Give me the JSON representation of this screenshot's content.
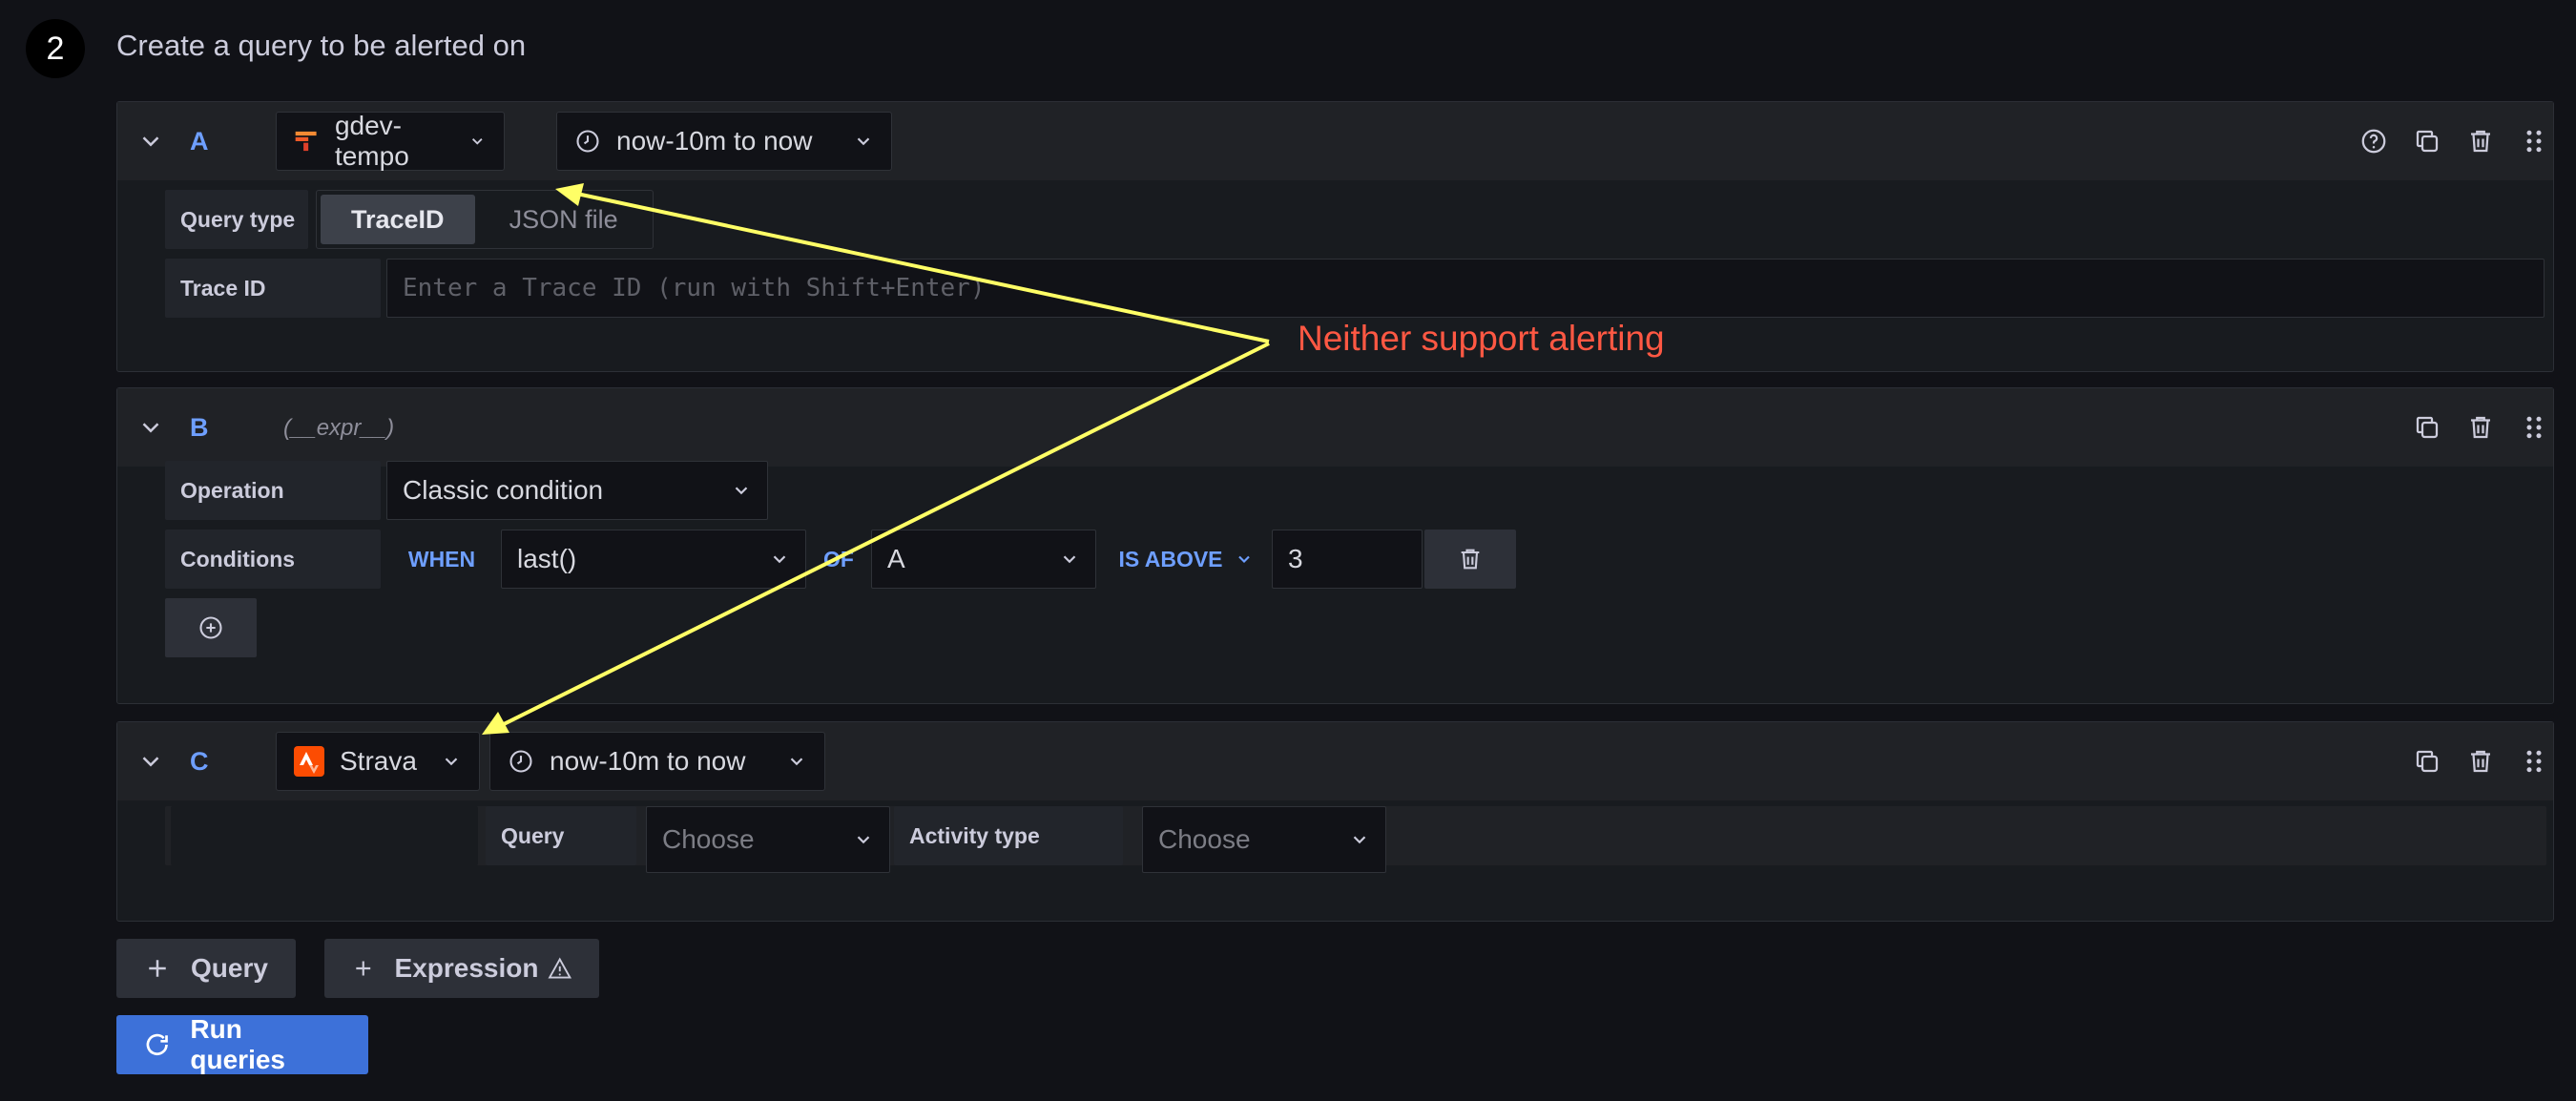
{
  "step": {
    "number": "2",
    "title": "Create a query to be alerted on"
  },
  "queries": {
    "a": {
      "ref_id": "A",
      "datasource": "gdev-tempo",
      "time_range": "now-10m to now",
      "query_type_label": "Query type",
      "query_type_options": [
        "TraceID",
        "JSON file"
      ],
      "trace_id_label": "Trace ID",
      "trace_id_placeholder": "Enter a Trace ID (run with Shift+Enter)"
    },
    "b": {
      "ref_id": "B",
      "hint": "(__expr__)",
      "operation_label": "Operation",
      "operation_value": "Classic condition",
      "conditions_label": "Conditions",
      "when": "WHEN",
      "reducer": "last()",
      "of": "OF",
      "query_ref": "A",
      "evaluator": "IS ABOVE",
      "threshold": "3"
    },
    "c": {
      "ref_id": "C",
      "datasource": "Strava",
      "time_range": "now-10m to now",
      "query_label": "Query",
      "query_placeholder": "Choose",
      "activity_label": "Activity type",
      "activity_placeholder": "Choose"
    }
  },
  "buttons": {
    "add_query": "Query",
    "add_expression": "Expression",
    "run_queries": "Run queries"
  },
  "annotation": {
    "text": "Neither support alerting",
    "color": "#ff5843",
    "arrow_color": "#ffff66"
  },
  "colors": {
    "accent": "#6e9fff",
    "primary_button": "#3d71d9",
    "background": "#111217"
  }
}
